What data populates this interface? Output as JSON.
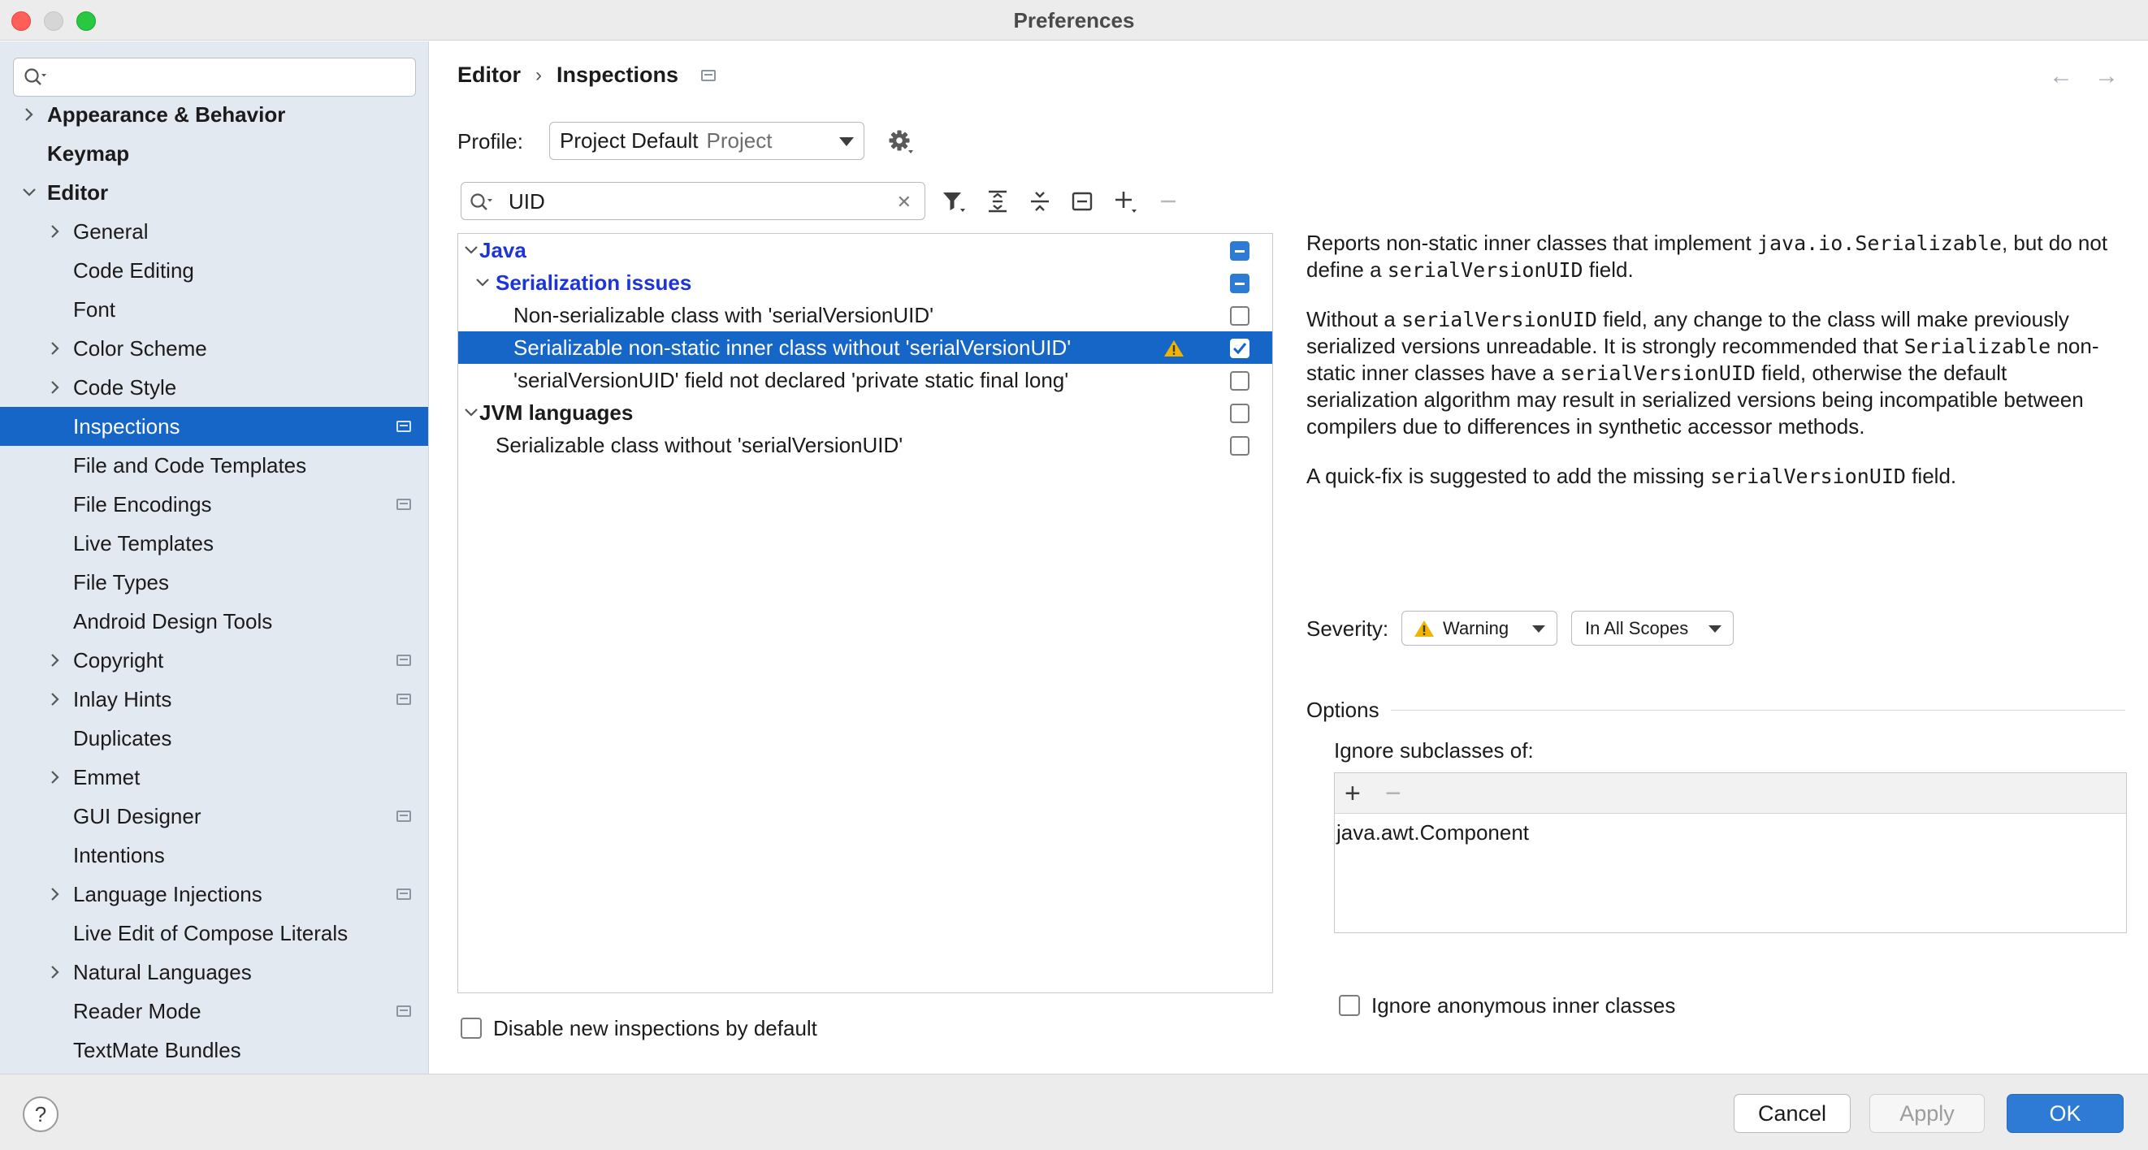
{
  "window": {
    "title": "Preferences"
  },
  "sidebar": {
    "search": {
      "value": "",
      "placeholder": ""
    },
    "items": [
      {
        "label": "Appearance & Behavior"
      },
      {
        "label": "Keymap"
      },
      {
        "label": "Editor"
      },
      {
        "label": "General"
      },
      {
        "label": "Code Editing"
      },
      {
        "label": "Font"
      },
      {
        "label": "Color Scheme"
      },
      {
        "label": "Code Style"
      },
      {
        "label": "Inspections"
      },
      {
        "label": "File and Code Templates"
      },
      {
        "label": "File Encodings"
      },
      {
        "label": "Live Templates"
      },
      {
        "label": "File Types"
      },
      {
        "label": "Android Design Tools"
      },
      {
        "label": "Copyright"
      },
      {
        "label": "Inlay Hints"
      },
      {
        "label": "Duplicates"
      },
      {
        "label": "Emmet"
      },
      {
        "label": "GUI Designer"
      },
      {
        "label": "Intentions"
      },
      {
        "label": "Language Injections"
      },
      {
        "label": "Live Edit of Compose Literals"
      },
      {
        "label": "Natural Languages"
      },
      {
        "label": "Reader Mode"
      },
      {
        "label": "TextMate Bundles"
      }
    ],
    "selected": "Inspections"
  },
  "breadcrumb": {
    "parent": "Editor",
    "current": "Inspections",
    "separator": "›"
  },
  "nav": {
    "back": "←",
    "forward": "→"
  },
  "profile": {
    "label": "Profile:",
    "value": "Project Default",
    "scope": "Project"
  },
  "inspection_search": {
    "value": "UID",
    "placeholder": ""
  },
  "tree": {
    "rows": [
      {
        "label": "Java",
        "state": "mixed"
      },
      {
        "label": "Serialization issues",
        "state": "mixed"
      },
      {
        "label": "Non-serializable class with 'serialVersionUID'",
        "state": "unchecked"
      },
      {
        "label": "Serializable non-static inner class without 'serialVersionUID'",
        "state": "checked",
        "severity": "warning"
      },
      {
        "label": "'serialVersionUID' field not declared 'private static final long'",
        "state": "unchecked"
      },
      {
        "label": "JVM languages",
        "state": "unchecked"
      },
      {
        "label": "Serializable class without 'serialVersionUID'",
        "state": "unchecked"
      }
    ]
  },
  "disable_new": {
    "label": "Disable new inspections by default",
    "checked": false
  },
  "description": {
    "p1": {
      "a": "Reports non-static inner classes that implement ",
      "code1": "java.io.Serializable",
      "b": ", but do not define a ",
      "code2": "serialVersionUID",
      "c": " field."
    },
    "p2": {
      "a": "Without a ",
      "code1": "serialVersionUID",
      "b": " field, any change to the class will make previously serialized versions unreadable. It is strongly recommended that ",
      "code2": "Serializable",
      "c": " non-static inner classes have a ",
      "code3": "serialVersionUID",
      "d": " field, otherwise the default serialization algorithm may result in serialized versions being incompatible between compilers due to differences in synthetic accessor methods."
    },
    "p3": {
      "a": "A quick-fix is suggested to add the missing ",
      "code1": "serialVersionUID",
      "b": " field."
    }
  },
  "severity": {
    "label": "Severity:",
    "value": "Warning",
    "scope": "In All Scopes"
  },
  "options": {
    "title": "Options",
    "ignore_label": "Ignore subclasses of:",
    "add": "+",
    "remove": "−",
    "items": [
      "java.awt.Component"
    ],
    "ignore_anonymous": {
      "label": "Ignore anonymous inner classes",
      "checked": false
    }
  },
  "buttons": {
    "help": "?",
    "cancel": "Cancel",
    "apply": "Apply",
    "ok": "OK"
  },
  "colors": {
    "accent": "#1566c6",
    "group_link": "#1d34d6",
    "warning": "#f0b400"
  }
}
